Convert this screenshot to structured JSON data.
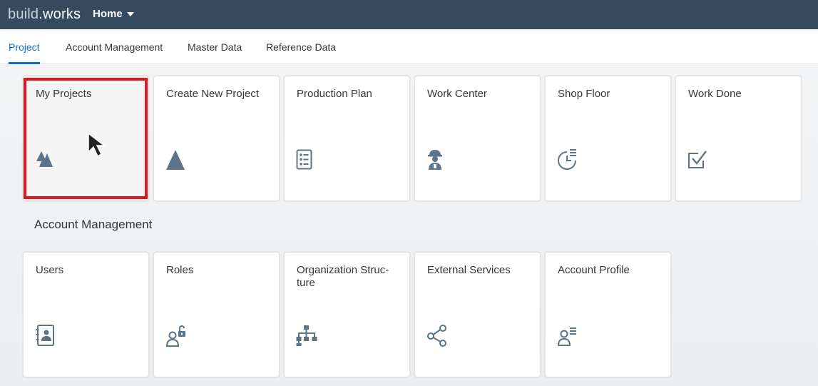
{
  "shell": {
    "brand_part1": "build",
    "brand_part2": ".works",
    "home_label": "Home"
  },
  "tabs": [
    {
      "label": "Project",
      "active": true
    },
    {
      "label": "Account Management",
      "active": false
    },
    {
      "label": "Master Data",
      "active": false
    },
    {
      "label": "Reference Data",
      "active": false
    }
  ],
  "project_tiles": [
    {
      "title": "My Projects",
      "icon": "mountains-icon"
    },
    {
      "title": "Create New Project",
      "icon": "triangle-icon"
    },
    {
      "title": "Production Plan",
      "icon": "checklist-icon"
    },
    {
      "title": "Work Center",
      "icon": "worker-icon"
    },
    {
      "title": "Shop Floor",
      "icon": "pie-list-icon"
    },
    {
      "title": "Work Done",
      "icon": "checkbox-icon"
    }
  ],
  "account_section_title": "Account Management",
  "account_tiles": [
    {
      "title": "Users",
      "icon": "address-book-icon"
    },
    {
      "title": "Roles",
      "icon": "user-lock-icon"
    },
    {
      "title": "Organization Struc-\nture",
      "icon": "org-chart-icon"
    },
    {
      "title": "External Services",
      "icon": "share-icon"
    },
    {
      "title": "Account Profile",
      "icon": "user-list-icon"
    }
  ],
  "colors": {
    "shell": "#354a5f",
    "accent": "#0a6ed1",
    "icon": "#5b738b",
    "highlight": "#e3161b"
  }
}
